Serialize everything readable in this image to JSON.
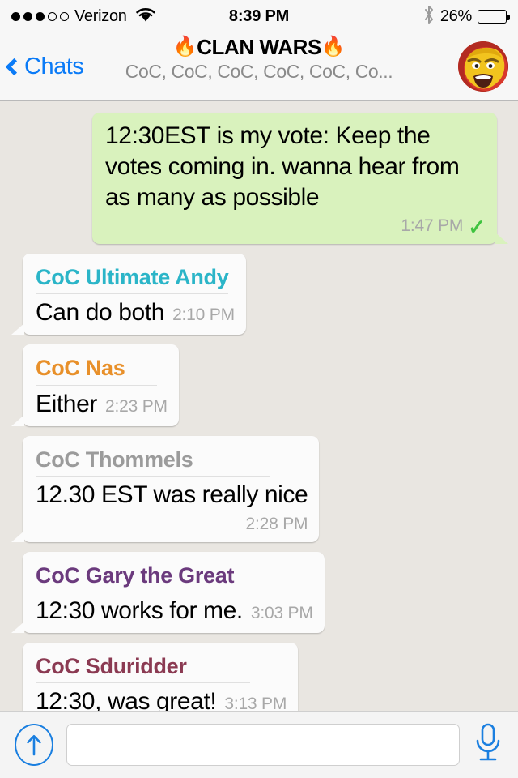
{
  "status_bar": {
    "signal_dots_filled": 3,
    "signal_dots_total": 5,
    "carrier": "Verizon",
    "wifi_icon": "wifi-icon",
    "time": "8:39 PM",
    "bluetooth_icon": "bluetooth-icon",
    "battery_percent": "26%",
    "battery_level": 26
  },
  "nav": {
    "back_label": "Chats",
    "back_icon": "chevron-left-icon",
    "title": "CLAN WARS",
    "title_emoji_left": "🔥",
    "title_emoji_right": "🔥",
    "subtitle": "CoC, CoC, CoC, CoC, CoC, Co...",
    "avatar_name": "group-avatar"
  },
  "colors": {
    "outgoing_bubble": "#d9f2bd",
    "incoming_bubble": "#fbfbfb",
    "chat_background": "#e9e6e1",
    "accent_blue": "#0b7bf7",
    "tick_green": "#3fc33f",
    "meta_gray": "#a8a8a8"
  },
  "messages": [
    {
      "direction": "out",
      "text": "12:30EST is my vote: Keep the votes coming in. wanna hear from as many as possible",
      "time": "1:47 PM",
      "status_icon": "single-check-icon",
      "tick": "✓"
    },
    {
      "direction": "in",
      "sender": "CoC Ultimate Andy",
      "sender_color": "#2bb5c8",
      "text": "Can do both",
      "time": "2:10 PM",
      "time_position": "inline"
    },
    {
      "direction": "in",
      "sender": "CoC Nas",
      "sender_color": "#e8902a",
      "text": "Either",
      "time": "2:23 PM",
      "time_position": "inline"
    },
    {
      "direction": "in",
      "sender": "CoC Thommels",
      "sender_color": "#9b9b9b",
      "text": "12.30 EST was really nice",
      "time": "2:28 PM",
      "time_position": "below"
    },
    {
      "direction": "in",
      "sender": "CoC Gary the Great",
      "sender_color": "#6b3a7d",
      "text": "12:30 works for me.",
      "time": "3:03 PM",
      "time_position": "inline"
    },
    {
      "direction": "in",
      "sender": "CoC Sduridder",
      "sender_color": "#8b3a52",
      "text": "12:30, was great!",
      "time": "3:13 PM",
      "time_position": "inline"
    }
  ],
  "input_bar": {
    "attach_icon": "arrow-up-circle-icon",
    "message_value": "",
    "message_placeholder": "",
    "mic_icon": "microphone-icon"
  }
}
